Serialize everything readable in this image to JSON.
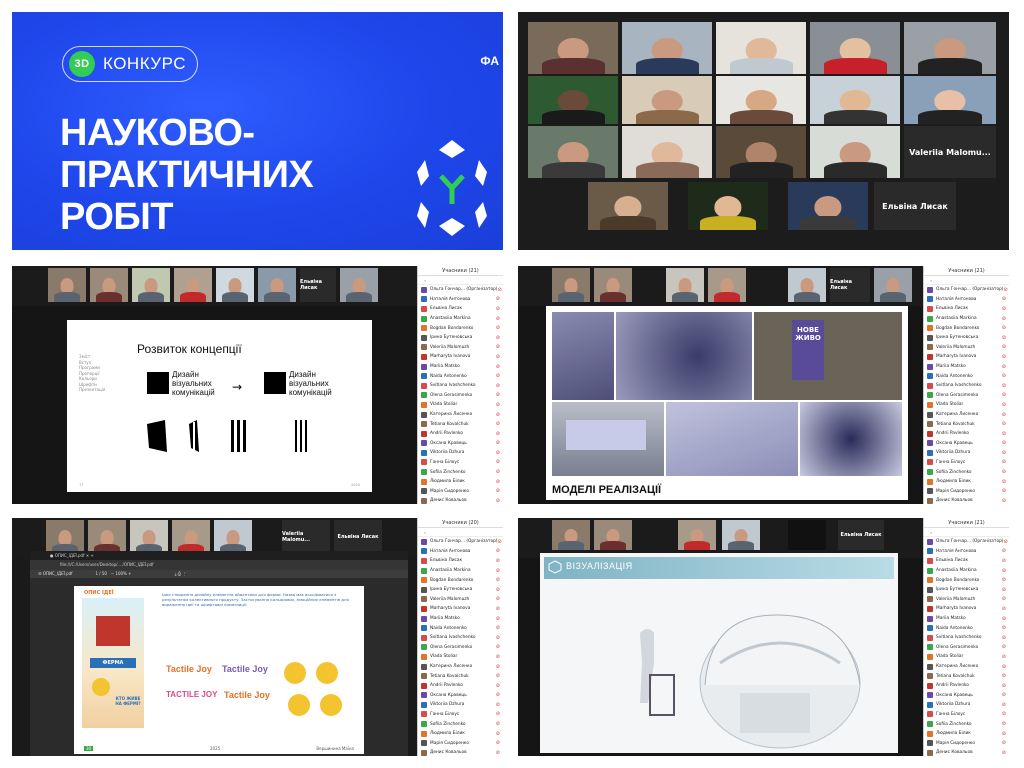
{
  "panel1": {
    "badge": "КОНКУРС",
    "badge_logo": "3D",
    "title_line1": "НАУКОВО-",
    "title_line2": "ПРАКТИЧНИХ",
    "title_line3": "РОБІТ",
    "corner_text": "ФА",
    "colors": {
      "blue": "#1e46ea",
      "green": "#33cc55"
    }
  },
  "panel2": {
    "name_card_1": "Valeriia Malomu...",
    "name_card_2": "Ельвіна Лисак"
  },
  "panel3": {
    "top_name": "Ельвіна Лисак",
    "sidebar_title": "Учасники (21)",
    "slide": {
      "title": "Розвиток концепції",
      "menu": [
        "Зміст",
        "Вступ",
        "Програми",
        "Пропорції",
        "Кольори",
        "Шрифти",
        "Презентація"
      ],
      "logo_text_1": "Дизайн\nвізуальних\nкомунікацій",
      "logo_text_2": "Дизайн\nвізуальних\nкомунікацій",
      "arrow": "→",
      "page_no": "17",
      "year": "2025"
    }
  },
  "panel4": {
    "top_name": "Ельвіна Лисак",
    "caption": "МОДЕЛІ РЕАЛІЗАЦІЇ",
    "billboard": "НОВЕ ЖИВО"
  },
  "panel5": {
    "top_name_1": "Valeriia Malomu...",
    "top_name_2": "Ельвіна Лисак",
    "sidebar_title": "Учасники (20)",
    "url": "file:///C:/Users/user/Desktop/..../ОПИС_ІДЕЇ.pdf",
    "page_title": "ОПИС ІДЕЇ",
    "page_text": "Ідея створення дизайну елементів айдентики для ферми. Назва має асоціюватися з результатом колективного продукту. Застосування кольорових, емоційних елементів для вираження ідеї та шрифтової композиції.",
    "farm_label": "ФЕРМА",
    "farm_q": "КТО ЖИВЕ НА ФЕРМІ?",
    "brand_1": "Tactile Joy",
    "brand_2": "TACTILE JOY",
    "footer_year": "2025",
    "footer_name": "Вершинина Маїна",
    "page_no": "30"
  },
  "panel6": {
    "top_name": "Ельвіна Лисак",
    "sidebar_title": "Учасники (21)",
    "slide_title": "ВІЗУАЛІЗАЦІЯ"
  },
  "participants": [
    "Ольга Гончар... (Організатор)",
    "Наталія Антонова",
    "Ельвіна Лисак",
    "Anastasiia Markina",
    "Bogdan Bondarenko",
    "Ірина Бутеновська",
    "Valeriia Malomuzh",
    "Marharyta Ivanova",
    "Mariia Matsko",
    "Naida Antonenko",
    "Svitlana Ivashchenko",
    "Olena Gerasimenko",
    "Vlada Stoliar",
    "Катерина Лисенко",
    "Tetiana Kovalchuk",
    "Andrii Pavlenko",
    "Оксана Кравець",
    "Viktoriia Dzhura",
    "Ганна Білоус",
    "Sofiia Zinchenko",
    "Людмила Білик",
    "Марія Сидоренко",
    "Денис Ковальов"
  ]
}
